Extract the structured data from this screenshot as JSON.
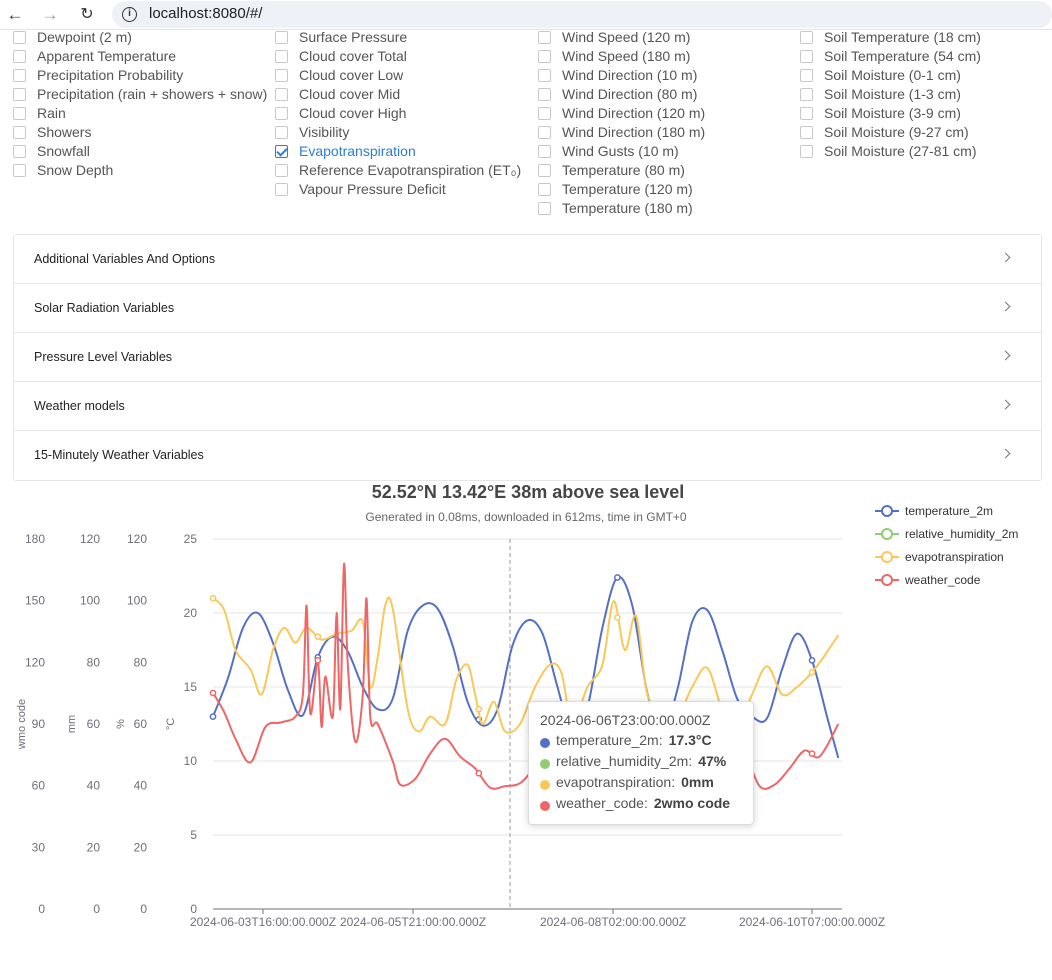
{
  "browser": {
    "url": "localhost:8080/#/"
  },
  "variables": {
    "columns": [
      {
        "items": [
          {
            "label": "Dewpoint (2 m)",
            "checked": false
          },
          {
            "label": "Apparent Temperature",
            "checked": false
          },
          {
            "label": "Precipitation Probability",
            "checked": false
          },
          {
            "label": "Precipitation (rain + showers + snow)",
            "checked": false
          },
          {
            "label": "Rain",
            "checked": false
          },
          {
            "label": "Showers",
            "checked": false
          },
          {
            "label": "Snowfall",
            "checked": false
          },
          {
            "label": "Snow Depth",
            "checked": false
          }
        ]
      },
      {
        "items": [
          {
            "label": "Surface Pressure",
            "checked": false
          },
          {
            "label": "Cloud cover Total",
            "checked": false
          },
          {
            "label": "Cloud cover Low",
            "checked": false
          },
          {
            "label": "Cloud cover Mid",
            "checked": false
          },
          {
            "label": "Cloud cover High",
            "checked": false
          },
          {
            "label": "Visibility",
            "checked": false
          },
          {
            "label": "Evapotranspiration",
            "checked": true
          },
          {
            "label": "Reference Evapotranspiration (ET₀)",
            "checked": false
          },
          {
            "label": "Vapour Pressure Deficit",
            "checked": false
          }
        ]
      },
      {
        "items": [
          {
            "label": "Wind Speed (120 m)",
            "checked": false
          },
          {
            "label": "Wind Speed (180 m)",
            "checked": false
          },
          {
            "label": "Wind Direction (10 m)",
            "checked": false
          },
          {
            "label": "Wind Direction (80 m)",
            "checked": false
          },
          {
            "label": "Wind Direction (120 m)",
            "checked": false
          },
          {
            "label": "Wind Direction (180 m)",
            "checked": false
          },
          {
            "label": "Wind Gusts (10 m)",
            "checked": false
          },
          {
            "label": "Temperature (80 m)",
            "checked": false
          },
          {
            "label": "Temperature (120 m)",
            "checked": false
          },
          {
            "label": "Temperature (180 m)",
            "checked": false
          }
        ]
      },
      {
        "items": [
          {
            "label": "Soil Temperature (18 cm)",
            "checked": false
          },
          {
            "label": "Soil Temperature (54 cm)",
            "checked": false
          },
          {
            "label": "Soil Moisture (0-1 cm)",
            "checked": false
          },
          {
            "label": "Soil Moisture (1-3 cm)",
            "checked": false
          },
          {
            "label": "Soil Moisture (3-9 cm)",
            "checked": false
          },
          {
            "label": "Soil Moisture (9-27 cm)",
            "checked": false
          },
          {
            "label": "Soil Moisture (27-81 cm)",
            "checked": false
          }
        ]
      }
    ]
  },
  "accordion": [
    "Additional Variables And Options",
    "Solar Radiation Variables",
    "Pressure Level Variables",
    "Weather models",
    "15-Minutely Weather Variables"
  ],
  "chart_header": {
    "title": "52.52°N 13.42°E 38m above sea level",
    "subtitle": "Generated in 0.08ms, downloaded in 612ms, time in GMT+0"
  },
  "chart_data": {
    "type": "line",
    "title": "52.52°N 13.42°E 38m above sea level",
    "subtitle": "Generated in 0.08ms, downloaded in 612ms, time in GMT+0",
    "x_tick_labels": [
      "2024-06-03T16:00:00.000Z",
      "2024-06-05T21:00:00.000Z",
      "2024-06-08T02:00:00.000Z",
      "2024-06-10T07:00:00.000Z"
    ],
    "x_start": "2024-06-03T00:00:00.000Z",
    "x_end": "2024-06-10T23:00:00.000Z",
    "y_axes": [
      {
        "unit": "°C",
        "min": 0,
        "max": 25,
        "ticks": [
          0,
          5,
          10,
          15,
          20,
          25
        ]
      },
      {
        "unit": "%",
        "min": 0,
        "max": 120,
        "ticks": [
          0,
          20,
          40,
          60,
          80,
          100,
          120
        ]
      },
      {
        "unit": "mm",
        "min": 0,
        "max": 120,
        "ticks": [
          0,
          20,
          40,
          60,
          80,
          100,
          120
        ]
      },
      {
        "unit": "wmo code",
        "min": 0,
        "max": 180,
        "ticks": [
          0,
          30,
          60,
          90,
          120,
          150,
          180
        ]
      }
    ],
    "series": [
      {
        "name": "temperature_2m",
        "color": "#5470c6",
        "axis": "°C",
        "points": [
          [
            0,
            13.0
          ],
          [
            4,
            15.6
          ],
          [
            8,
            19.0
          ],
          [
            12,
            20.0
          ],
          [
            16,
            18.0
          ],
          [
            20,
            14.8
          ],
          [
            24,
            13.1
          ],
          [
            28,
            17.0
          ],
          [
            32,
            18.4
          ],
          [
            36,
            17.4
          ],
          [
            40,
            15.0
          ],
          [
            44,
            13.5
          ],
          [
            48,
            14.2
          ],
          [
            52,
            18.8
          ],
          [
            56,
            20.5
          ],
          [
            60,
            20.3
          ],
          [
            64,
            17.8
          ],
          [
            68,
            14.0
          ],
          [
            72,
            12.4
          ],
          [
            76,
            13.5
          ],
          [
            80,
            17.8
          ],
          [
            84,
            19.5
          ],
          [
            88,
            18.6
          ],
          [
            92,
            15.0
          ],
          [
            96,
            11.8
          ],
          [
            100,
            13.6
          ],
          [
            104,
            19.0
          ],
          [
            108,
            22.4
          ],
          [
            112,
            20.5
          ],
          [
            116,
            14.6
          ],
          [
            120,
            12.0
          ],
          [
            124,
            14.8
          ],
          [
            128,
            19.4
          ],
          [
            132,
            20.2
          ],
          [
            136,
            17.5
          ],
          [
            140,
            14.2
          ],
          [
            144,
            13.0
          ],
          [
            148,
            12.9
          ],
          [
            152,
            16.2
          ],
          [
            156,
            18.6
          ],
          [
            160,
            16.8
          ],
          [
            164,
            13.0
          ],
          [
            167,
            10.2
          ]
        ]
      },
      {
        "name": "relative_humidity_2m",
        "color": "#91cc75",
        "axis": "%",
        "points": []
      },
      {
        "name": "evapotranspiration",
        "color": "#fac858",
        "axis": "mm",
        "points": [
          [
            0,
            21.0
          ],
          [
            3,
            20.2
          ],
          [
            6,
            17.5
          ],
          [
            10,
            16.2
          ],
          [
            13,
            14.5
          ],
          [
            16,
            17.5
          ],
          [
            19,
            19.0
          ],
          [
            22,
            18.0
          ],
          [
            25,
            19.0
          ],
          [
            29,
            18.2
          ],
          [
            33,
            18.6
          ],
          [
            37,
            18.8
          ],
          [
            40,
            19.4
          ],
          [
            42,
            15.0
          ],
          [
            44,
            17.0
          ],
          [
            46,
            20.5
          ],
          [
            48,
            20.3
          ],
          [
            52,
            13.5
          ],
          [
            55,
            12.0
          ],
          [
            58,
            13.0
          ],
          [
            62,
            12.5
          ],
          [
            65,
            15.5
          ],
          [
            68,
            16.5
          ],
          [
            70,
            14.5
          ],
          [
            72,
            12.5
          ],
          [
            75,
            14.0
          ],
          [
            78,
            12.0
          ],
          [
            82,
            12.5
          ],
          [
            86,
            15.0
          ],
          [
            90,
            16.5
          ],
          [
            93,
            16.0
          ],
          [
            96,
            12.6
          ],
          [
            100,
            15.0
          ],
          [
            104,
            16.5
          ],
          [
            107,
            20.8
          ],
          [
            110,
            17.5
          ],
          [
            113,
            19.8
          ],
          [
            116,
            14.5
          ],
          [
            120,
            13.5
          ],
          [
            124,
            13.0
          ],
          [
            128,
            15.0
          ],
          [
            132,
            16.3
          ],
          [
            136,
            13.5
          ],
          [
            140,
            12.3
          ],
          [
            144,
            14.5
          ],
          [
            148,
            16.4
          ],
          [
            152,
            14.5
          ],
          [
            156,
            15.0
          ],
          [
            160,
            16.0
          ],
          [
            163,
            17.0
          ],
          [
            167,
            18.5
          ]
        ]
      },
      {
        "name": "weather_code",
        "color": "#ee6666",
        "axis": "wmo code",
        "points": [
          [
            0,
            14.6
          ],
          [
            3,
            13.3
          ],
          [
            6,
            11.5
          ],
          [
            10,
            9.9
          ],
          [
            14,
            12.3
          ],
          [
            18,
            12.6
          ],
          [
            22,
            13.0
          ],
          [
            24,
            14.5
          ],
          [
            25,
            20.5
          ],
          [
            26,
            13.2
          ],
          [
            28,
            16.8
          ],
          [
            29,
            12.3
          ],
          [
            30,
            15.7
          ],
          [
            32,
            13.0
          ],
          [
            33,
            20.0
          ],
          [
            34,
            13.5
          ],
          [
            35,
            23.3
          ],
          [
            36,
            16.5
          ],
          [
            38,
            11.3
          ],
          [
            40,
            14.5
          ],
          [
            41,
            21.0
          ],
          [
            42,
            13.0
          ],
          [
            44,
            12.5
          ],
          [
            48,
            10.0
          ],
          [
            50,
            8.4
          ],
          [
            54,
            8.8
          ],
          [
            58,
            10.5
          ],
          [
            62,
            11.5
          ],
          [
            66,
            10.3
          ],
          [
            70,
            9.5
          ],
          [
            74,
            8.2
          ],
          [
            78,
            8.3
          ],
          [
            82,
            8.5
          ],
          [
            86,
            9.6
          ],
          [
            90,
            11.0
          ],
          [
            94,
            11.5
          ],
          [
            98,
            11.0
          ],
          [
            102,
            11.2
          ],
          [
            106,
            11.5
          ],
          [
            110,
            11.0
          ],
          [
            114,
            10.6
          ],
          [
            118,
            11.5
          ],
          [
            122,
            11.3
          ],
          [
            126,
            10.0
          ],
          [
            130,
            9.2
          ],
          [
            134,
            12.4
          ],
          [
            138,
            11.3
          ],
          [
            142,
            10.6
          ],
          [
            146,
            8.3
          ],
          [
            150,
            8.4
          ],
          [
            154,
            9.5
          ],
          [
            158,
            10.7
          ],
          [
            162,
            10.3
          ],
          [
            167,
            12.5
          ]
        ]
      }
    ],
    "markers_every_hours": 24,
    "axis_pointer_hour": 71,
    "tooltip": {
      "time": "2024-06-06T23:00:00.000Z",
      "rows": [
        {
          "name": "temperature_2m",
          "value": "17.3°C",
          "color": "#5470c6"
        },
        {
          "name": "relative_humidity_2m",
          "value": "47%",
          "color": "#91cc75"
        },
        {
          "name": "evapotranspiration",
          "value": "0mm",
          "color": "#fac858"
        },
        {
          "name": "weather_code",
          "value": "2wmo code",
          "color": "#ee6666"
        }
      ]
    },
    "legend": [
      "temperature_2m",
      "relative_humidity_2m",
      "evapotranspiration",
      "weather_code"
    ],
    "legend_position": "top-right",
    "grid": true
  }
}
